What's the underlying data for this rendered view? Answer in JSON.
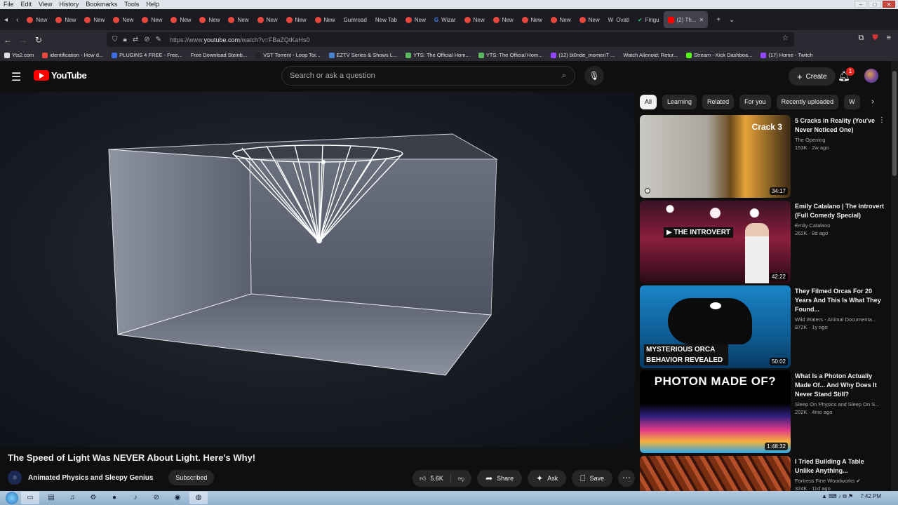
{
  "browser": {
    "menu": [
      "File",
      "Edit",
      "View",
      "History",
      "Bookmarks",
      "Tools",
      "Help"
    ],
    "tabs": [
      "New",
      "New",
      "New",
      "New",
      "New",
      "New",
      "New",
      "New",
      "New",
      "New",
      "New",
      "Gumroad",
      "New Tab",
      "New",
      "Wizar",
      "New",
      "New",
      "New",
      "New",
      "New",
      "Ovati",
      "Fingu",
      "(2) Th..."
    ],
    "url_prefix": "https://www.",
    "url_host": "youtube.com",
    "url_path": "/watch?v=FBaZQtKaHs0",
    "bookmarks": [
      "Yts2.com",
      "identification - How d...",
      "PLUGINS 4 FREE - Free...",
      "Free Download Steinb...",
      "VST Torrent - Loop Tor...",
      "EZTV Series & Shows L...",
      "YTS: The Official Hom...",
      "YTS: The Official Hom...",
      "(12) bl0nde_momenT ...",
      "Watch Alienoid: Retur...",
      "Stream - Kick Dashboa...",
      "(17) Home - Twitch"
    ]
  },
  "youtube": {
    "logo_text": "YouTube",
    "search_placeholder": "Search or ask a question",
    "create_label": "Create",
    "notif_count": "1",
    "chips": [
      "All",
      "Learning",
      "Related",
      "For you",
      "Recently uploaded",
      "W"
    ],
    "video": {
      "title": "The Speed of Light Was NEVER About Light. Here's Why!",
      "channel": "Animated Physics and Sleepy Genius",
      "subscribed_label": "Subscribed",
      "likes": "5.6K",
      "share_label": "Share",
      "ask_label": "Ask",
      "save_label": "Save"
    },
    "recommended": [
      {
        "title": "5 Cracks in Reality (You've Never Noticed One)",
        "channel": "The Opening",
        "stats": "153K · 2w ago",
        "duration": "34:17",
        "overlay": "Crack 3"
      },
      {
        "title": "Emily Catalano | The Introvert (Full Comedy Special)",
        "channel": "Emily Catalano",
        "stats": "262K · 8d ago",
        "duration": "42:22",
        "overlay": "▶ THE INTROVERT"
      },
      {
        "title": "They Filmed Orcas For 20 Years And This Is What They Found...",
        "channel": "Wild Waters - Animal Documenta...",
        "stats": "872K · 1y ago",
        "duration": "50:02",
        "overlay": "MYSTERIOUS ORCA BEHAVIOR REVEALED"
      },
      {
        "title": "What Is a Photon Actually Made Of... And Why Does It Never Stand Still?",
        "channel": "Sleep On Physics and Sleep On S...",
        "stats": "202K · 4mo ago",
        "duration": "1:48:32",
        "overlay": "PHOTON MADE OF?"
      },
      {
        "title": "I Tried Building A Table Unlike Anything...",
        "channel": "Fortress Fine Woodworks",
        "stats": "324K · 11d ago",
        "duration": "",
        "overlay": ""
      }
    ]
  },
  "taskbar": {
    "time": "7:42 PM"
  },
  "colors": {
    "yt_red": "#ff0000",
    "bg": "#0f0f0f",
    "chip": "#272727"
  }
}
